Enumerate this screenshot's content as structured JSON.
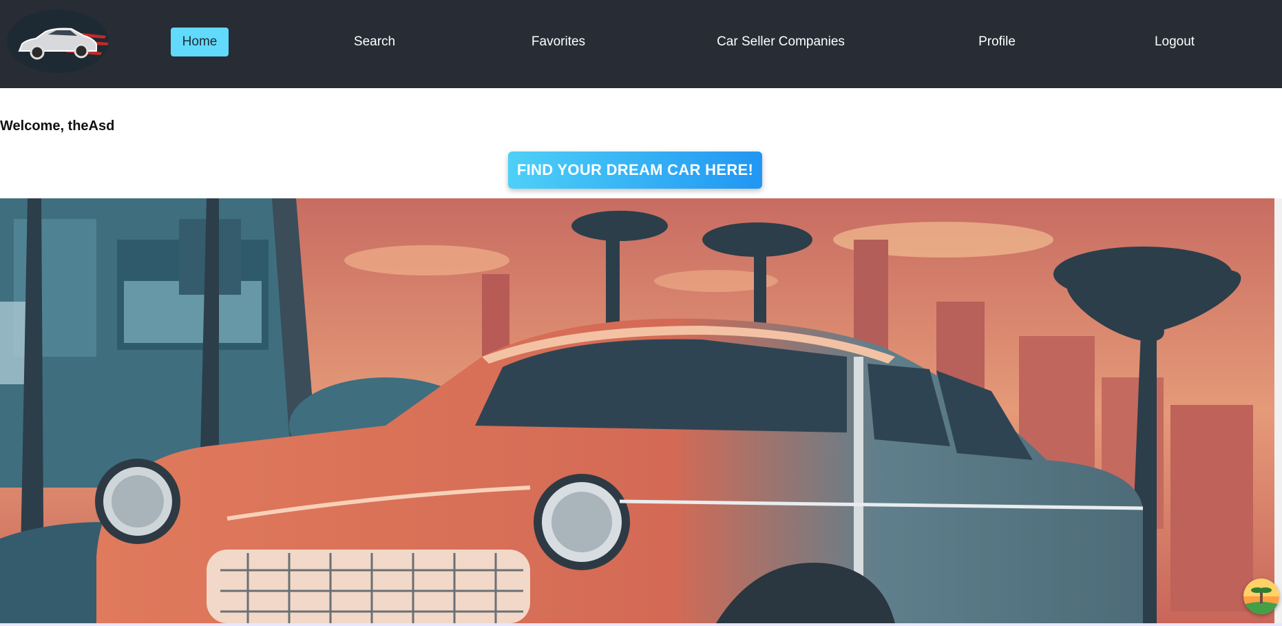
{
  "app": {
    "logo_icon": "car-logo-icon"
  },
  "nav": {
    "items": [
      {
        "label": "Home",
        "active": true
      },
      {
        "label": "Search",
        "active": false
      },
      {
        "label": "Favorites",
        "active": false
      },
      {
        "label": "Car Seller Companies",
        "active": false
      },
      {
        "label": "Profile",
        "active": false
      },
      {
        "label": "Logout",
        "active": false
      }
    ]
  },
  "main": {
    "welcome_text": "Welcome, theAsd",
    "cta_label": "FIND YOUR DREAM CAR HERE!",
    "hero_image": "retro-car-sunset-city-illustration"
  },
  "floating_button": {
    "icon": "palm-island-icon"
  },
  "colors": {
    "navbar_bg": "#282c34",
    "accent": "#61dafb",
    "cta_start": "#4dd0f7",
    "cta_end": "#2196f3"
  }
}
